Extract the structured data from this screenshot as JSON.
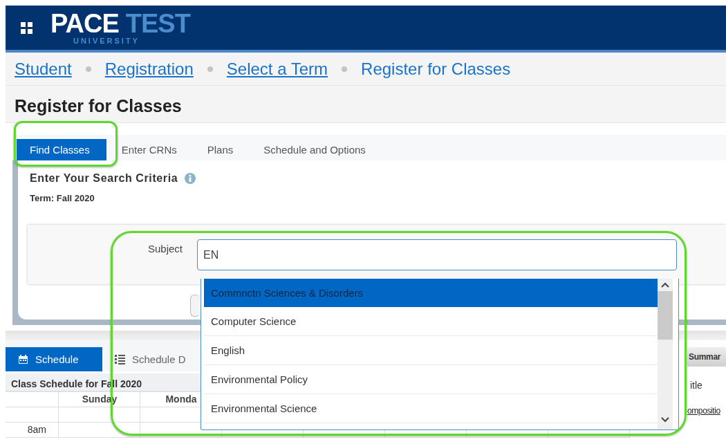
{
  "header": {
    "logo_main": "PACE",
    "logo_accent": "TEST",
    "logo_sub": "UNIVERSITY"
  },
  "breadcrumbs": [
    {
      "label": "Student",
      "link": true
    },
    {
      "label": "Registration",
      "link": true
    },
    {
      "label": "Select a Term",
      "link": true
    },
    {
      "label": "Register for Classes",
      "link": false
    }
  ],
  "page_title": "Register for Classes",
  "tabs": [
    {
      "label": "Find Classes",
      "selected": true
    },
    {
      "label": "Enter CRNs",
      "selected": false
    },
    {
      "label": "Plans",
      "selected": false
    },
    {
      "label": "Schedule and Options",
      "selected": false
    }
  ],
  "search": {
    "heading": "Enter Your Search Criteria",
    "term": "Term: Fall 2020",
    "subject_label": "Subject",
    "subject_value": "EN",
    "suggestions": [
      {
        "label": "Commnctn Sciences & Disorders",
        "selected": true
      },
      {
        "label": "Computer Science",
        "selected": false
      },
      {
        "label": "English",
        "selected": false
      },
      {
        "label": "Environmental Policy",
        "selected": false
      },
      {
        "label": "Environmental Science",
        "selected": false
      }
    ]
  },
  "schedule": {
    "tabs": [
      {
        "label": "Schedule",
        "kind": "calendar",
        "selected": true
      },
      {
        "label": "Schedule D",
        "kind": "list",
        "selected": false
      }
    ],
    "title": "Class Schedule for Fall 2020",
    "days": [
      "Sunday",
      "Monda"
    ],
    "times": [
      "8am"
    ],
    "summary": {
      "tab": "Summar",
      "column": "itle",
      "link": "ompositio"
    }
  }
}
